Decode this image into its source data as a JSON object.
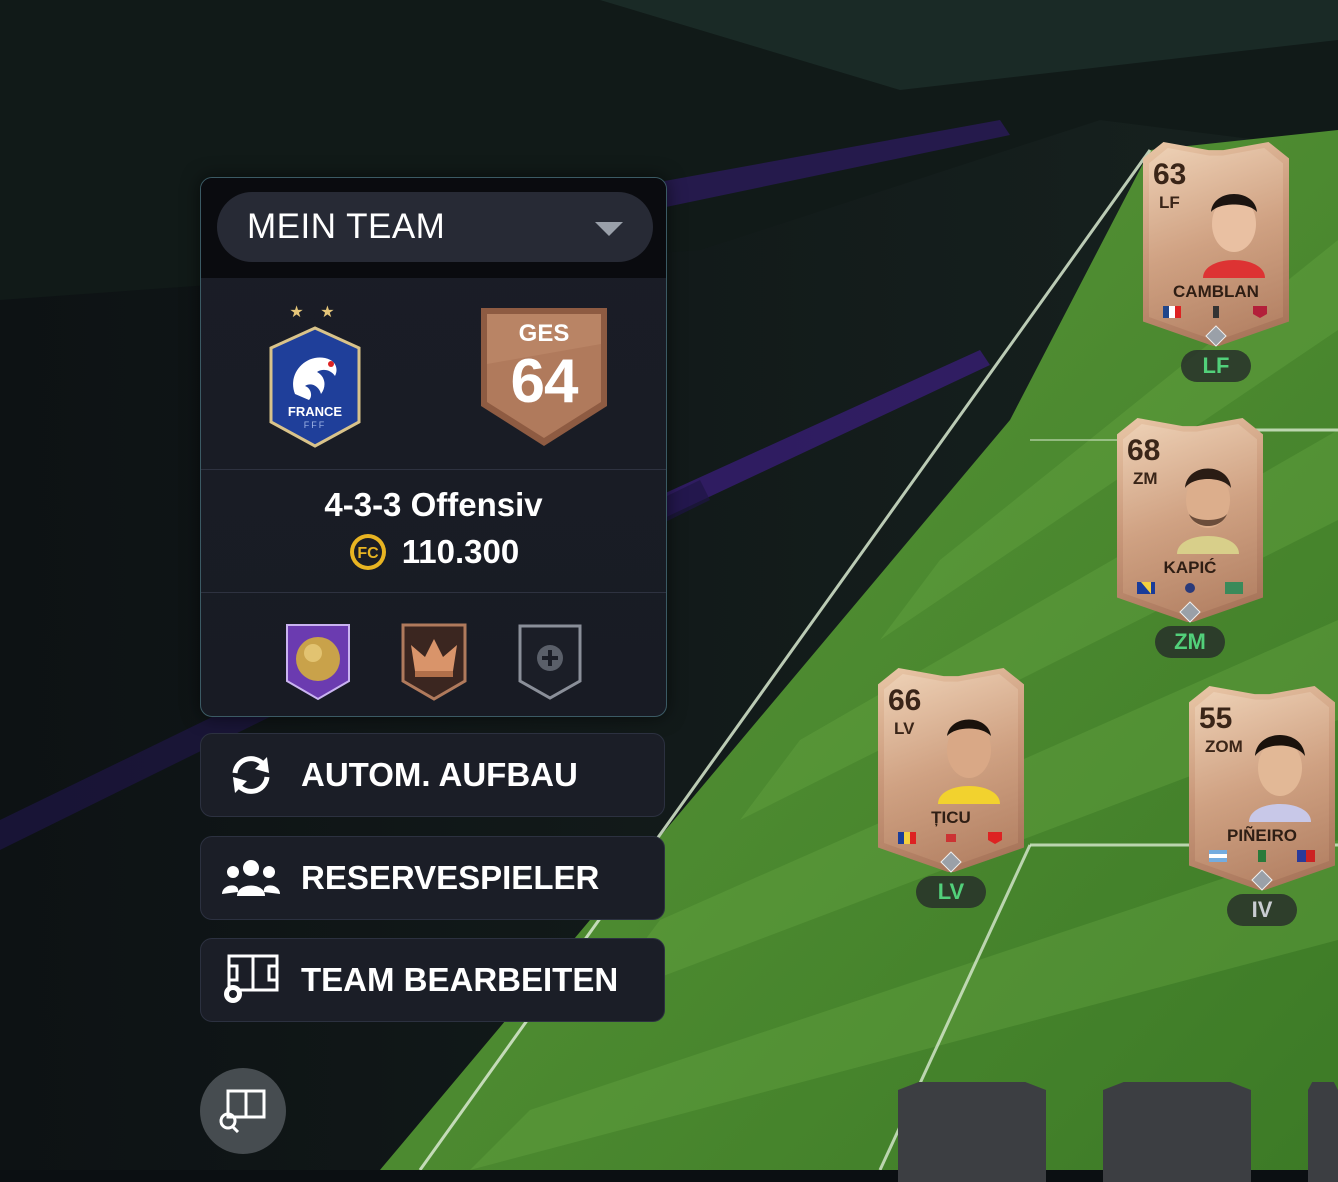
{
  "team_selector": {
    "label": "MEIN TEAM"
  },
  "crest": {
    "name": "FRANCE",
    "sub": "FFF",
    "stars": "★ ★"
  },
  "ges": {
    "label": "GES",
    "value": "64"
  },
  "formation": "4-3-3 Offensiv",
  "coins": "110.300",
  "actions": {
    "auto_build": "AUTOM. AUFBAU",
    "reserves": "RESERVESPIELER",
    "edit_team": "TEAM BEARBEITEN"
  },
  "players": [
    {
      "rating": "63",
      "card_pos": "LF",
      "name": "CAMBLAN",
      "slot_pos": "LF"
    },
    {
      "rating": "68",
      "card_pos": "ZM",
      "name": "KAPIĆ",
      "slot_pos": "ZM"
    },
    {
      "rating": "66",
      "card_pos": "LV",
      "name": "ȚICU",
      "slot_pos": "LV"
    },
    {
      "rating": "55",
      "card_pos": "ZOM",
      "name": "PIÑEIRO",
      "slot_pos": "IV"
    }
  ],
  "colors": {
    "accent_green": "#52d07a",
    "bronze": "#b07a5c",
    "panel": "#181b24"
  },
  "icons": [
    "chevron-down-icon",
    "france-crest-icon",
    "coin-icon",
    "ball-chemistry-icon",
    "crown-chemistry-icon",
    "add-slot-icon",
    "refresh-icon",
    "users-icon",
    "pitch-gear-icon",
    "pitch-search-icon"
  ]
}
